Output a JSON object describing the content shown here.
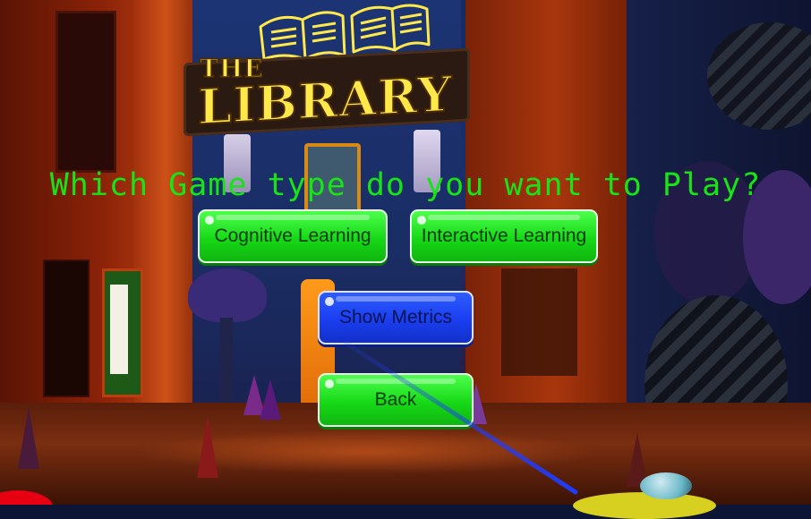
{
  "logo": {
    "the": "THE",
    "title": "LIBRARY",
    "icon": "open-books-icon"
  },
  "heading": "Which Game type do you want to Play?",
  "buttons": {
    "cognitive": "Cognitive Learning",
    "interactive": "Interactive Learning",
    "metrics": "Show Metrics",
    "back": "Back"
  },
  "colors": {
    "heading_text": "#17e317",
    "button_green": "#17d917",
    "button_blue": "#1a3ef0",
    "logo_text": "#ffe94a",
    "pointer": "#1f3cff"
  },
  "icons": [
    "open-books-icon",
    "vr-controller-icon",
    "laser-pointer"
  ]
}
